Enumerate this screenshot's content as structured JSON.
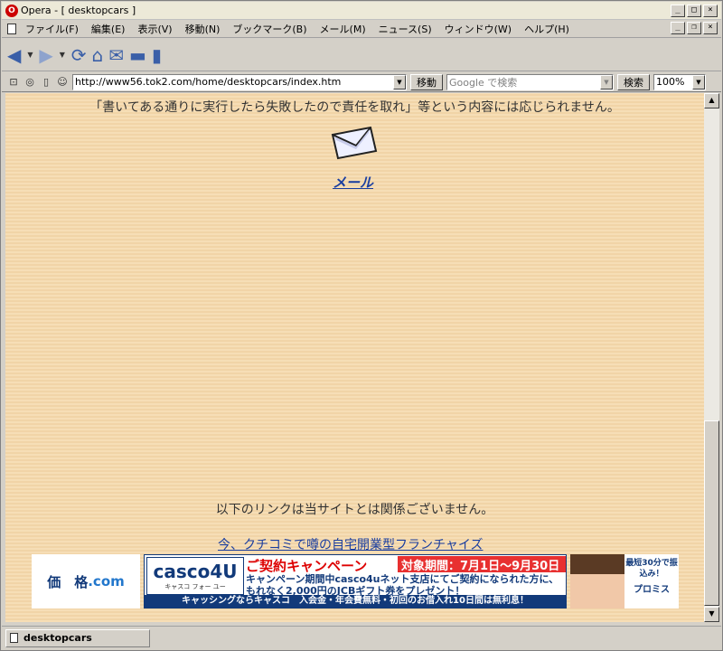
{
  "window": {
    "title": "Opera - [ desktopcars ]"
  },
  "menu": [
    "ファイル(F)",
    "編集(E)",
    "表示(V)",
    "移動(N)",
    "ブックマーク(B)",
    "メール(M)",
    "ニュース(S)",
    "ウィンドウ(W)",
    "ヘルプ(H)"
  ],
  "address": {
    "url": "http://www56.tok2.com/home/desktopcars/index.htm",
    "go_label": "移動",
    "search_placeholder": "Google で検索",
    "search_label": "検索",
    "zoom": "100%"
  },
  "content": {
    "warning_text": "「書いてある通りに実行したら失敗したので責任を取れ」等という内容には応じられません。",
    "mail_label": "メール",
    "disclaimer": "以下のリンクは当サイトとは関係ございません。",
    "ad_link": "今、クチコミで噂の自宅開業型フランチャイズ"
  },
  "banners": {
    "price": {
      "main": "価　格",
      "suffix": ".com"
    },
    "casco": {
      "logo": "casco4U",
      "logo_sub": "キャスコ フォー ユー",
      "title": "ご契約キャンペーン",
      "period": "対象期間：7月1日〜9月30日",
      "body": "キャンペーン期間中casco4uネット支店にてご契約になられた方に、もれなく2,000円のJCBギフト券をプレゼント！",
      "footer": "キャッシングならキャスコ　入会金・年会費無料・初回のお借入れ10日間は無利息！"
    },
    "promise": {
      "text": "最短30分で振込み！",
      "brand": "プロミス"
    }
  },
  "status": {
    "tab_label": "desktopcars"
  }
}
